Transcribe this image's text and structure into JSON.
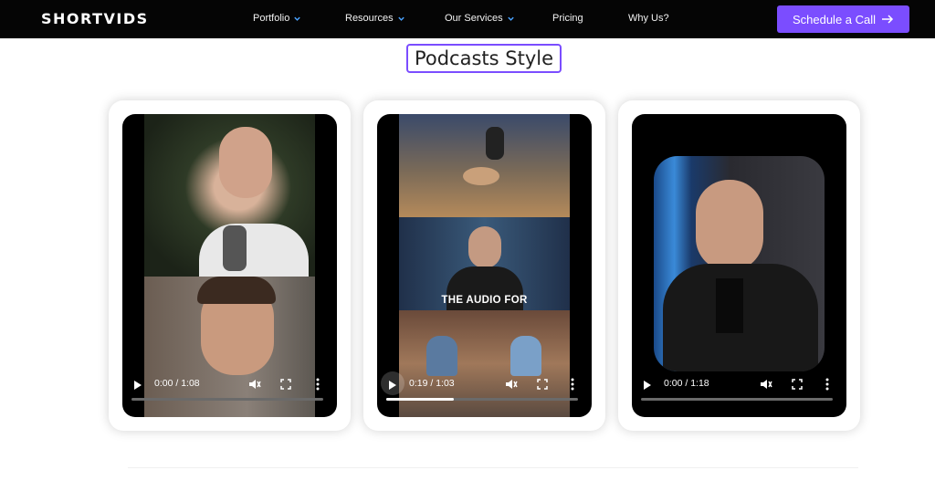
{
  "nav": {
    "logo": "SHORTVIDS",
    "items": [
      {
        "label": "Portfolio",
        "has_chevron": true
      },
      {
        "label": "Resources",
        "has_chevron": true
      },
      {
        "label": "Our Services",
        "has_chevron": true
      },
      {
        "label": "Pricing",
        "has_chevron": false
      },
      {
        "label": "Why Us?",
        "has_chevron": false
      }
    ],
    "cta_label": "Schedule a Call"
  },
  "section": {
    "title": "Podcasts Style"
  },
  "videos": [
    {
      "time": "0:00 / 1:08",
      "progress": 0.0,
      "caption": "",
      "muted": true
    },
    {
      "time": "0:19 / 1:03",
      "progress": 0.35,
      "caption": "THE AUDIO FOR",
      "muted": true
    },
    {
      "time": "0:00 / 1:18",
      "progress": 0.0,
      "caption": "",
      "muted": true
    }
  ],
  "colors": {
    "accent": "#7b4dff",
    "nav_bg": "#050505",
    "chevron": "#4aa3ff"
  },
  "icons": [
    "play-icon",
    "mute-icon",
    "fullscreen-icon",
    "more-options-icon",
    "chevron-down-icon",
    "arrow-right-icon"
  ]
}
